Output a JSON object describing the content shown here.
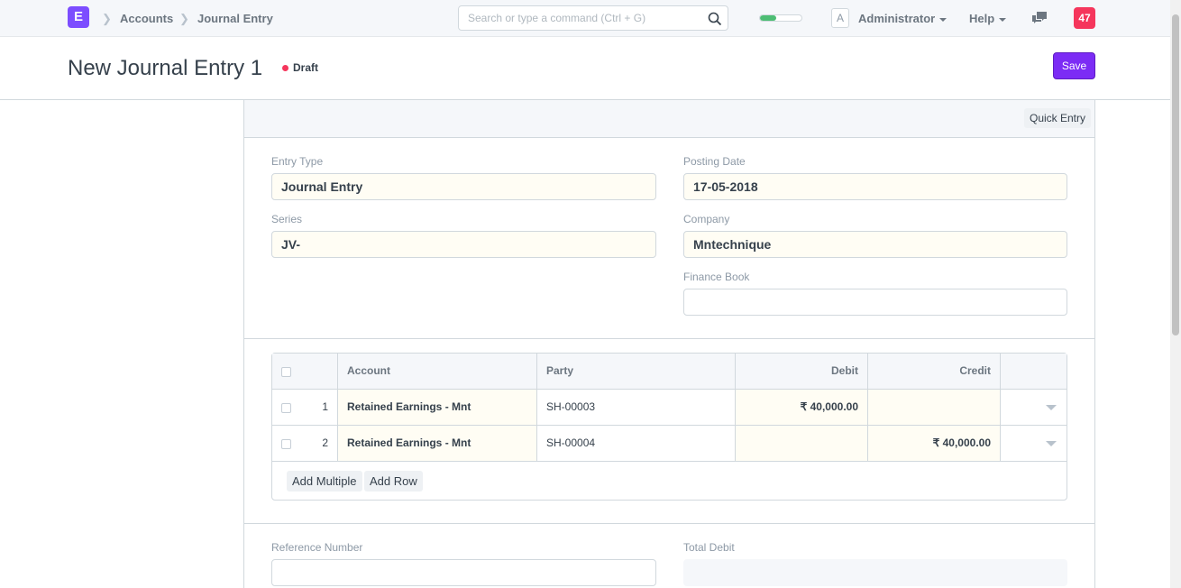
{
  "navbar": {
    "logo_letter": "E",
    "breadcrumbs": [
      "Accounts",
      "Journal Entry"
    ],
    "search_placeholder": "Search or type a command (Ctrl + G)",
    "progress_percent": 40,
    "avatar_letter": "A",
    "user_label": "Administrator",
    "help_label": "Help",
    "notification_count": "47"
  },
  "page": {
    "title": "New Journal Entry 1",
    "status": "Draft",
    "save_label": "Save"
  },
  "toolbar": {
    "quick_entry_label": "Quick Entry"
  },
  "form": {
    "entry_type": {
      "label": "Entry Type",
      "value": "Journal Entry"
    },
    "posting_date": {
      "label": "Posting Date",
      "value": "17-05-2018"
    },
    "series": {
      "label": "Series",
      "value": "JV-"
    },
    "company": {
      "label": "Company",
      "value": "Mntechnique"
    },
    "finance_book": {
      "label": "Finance Book",
      "value": ""
    },
    "reference_number": {
      "label": "Reference Number",
      "value": ""
    },
    "total_debit": {
      "label": "Total Debit",
      "value": ""
    }
  },
  "accounts_table": {
    "columns": [
      "Account",
      "Party",
      "Debit",
      "Credit"
    ],
    "rows": [
      {
        "idx": "1",
        "account": "Retained Earnings - Mnt",
        "party": "SH-00003",
        "debit": "₹ 40,000.00",
        "credit": ""
      },
      {
        "idx": "2",
        "account": "Retained Earnings - Mnt",
        "party": "SH-00004",
        "debit": "",
        "credit": "₹ 40,000.00"
      }
    ],
    "add_multiple_label": "Add Multiple",
    "add_row_label": "Add Row"
  },
  "colors": {
    "brand": "#7c4dff",
    "primary_button": "#7c2cf5",
    "notification": "#f5365c",
    "draft_indicator": "#f5365c",
    "progress": "#4dbd74"
  }
}
